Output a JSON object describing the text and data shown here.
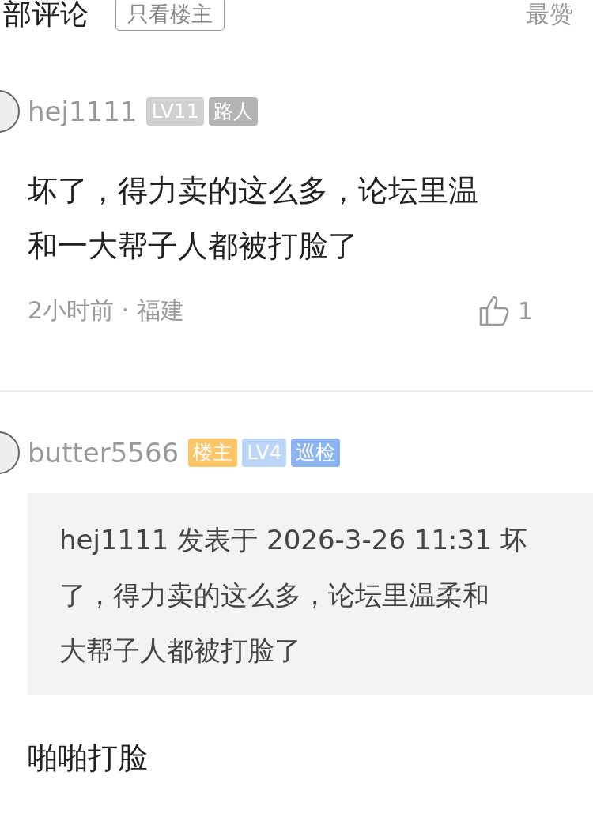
{
  "header": {
    "title": "部评论",
    "filter_button": "只看楼主",
    "sort": "最赞"
  },
  "comments": [
    {
      "username": "hej1111",
      "badges": [
        {
          "text": "LV11",
          "color": "#d0d0d0"
        },
        {
          "text": "路人",
          "color": "#b4b4b4"
        }
      ],
      "text_lines": [
        "坏了，得力卖的这么多，论坛里温",
        "和一大帮子人都被打脸了"
      ],
      "meta": "2小时前 · 福建",
      "likes": "1"
    },
    {
      "username": "butter5566",
      "badges": [
        {
          "text": "楼主",
          "color": "#fbc466"
        },
        {
          "text": "LV4",
          "color": "#bcd6f8"
        },
        {
          "text": "巡检",
          "color": "#8cb4f0"
        }
      ],
      "quote_lines": [
        "hej1111 发表于 2026-3-26 11:31 坏",
        "了，得力卖的这么多，论坛里温柔和",
        "大帮子人都被打脸了"
      ],
      "text_lines": [
        "啪啪打脸"
      ]
    }
  ]
}
